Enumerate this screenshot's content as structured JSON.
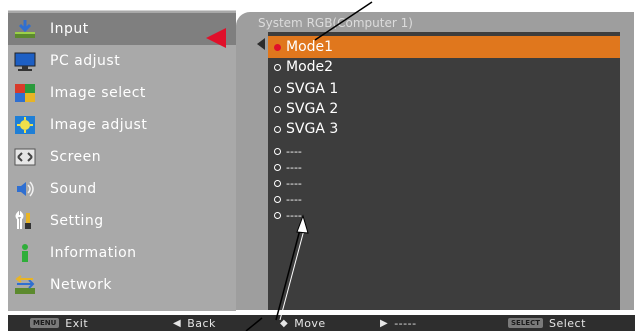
{
  "menu": {
    "items": [
      {
        "label": "Input",
        "icon": "input-icon"
      },
      {
        "label": "PC adjust",
        "icon": "monitor-icon"
      },
      {
        "label": "Image select",
        "icon": "image-select-icon"
      },
      {
        "label": "Image adjust",
        "icon": "image-adjust-icon"
      },
      {
        "label": "Screen",
        "icon": "screen-icon"
      },
      {
        "label": "Sound",
        "icon": "speaker-icon"
      },
      {
        "label": "Setting",
        "icon": "wrench-icon"
      },
      {
        "label": "Information",
        "icon": "information-icon"
      },
      {
        "label": "Network",
        "icon": "network-icon"
      }
    ],
    "selected_index": 0
  },
  "submenu": {
    "title": "System  RGB(Computer 1)",
    "options": [
      {
        "label": "Mode1",
        "selected": true
      },
      {
        "label": "Mode2",
        "selected": false
      },
      {
        "label": "SVGA 1",
        "selected": false
      },
      {
        "label": "SVGA 2",
        "selected": false
      },
      {
        "label": "SVGA 3",
        "selected": false
      },
      {
        "label": "----",
        "selected": false
      },
      {
        "label": "----",
        "selected": false
      },
      {
        "label": "----",
        "selected": false
      },
      {
        "label": "----",
        "selected": false
      },
      {
        "label": "----",
        "selected": false
      }
    ]
  },
  "bottom_bar": {
    "exit_key": "MENU",
    "exit_label": "Exit",
    "back_label": "Back",
    "move_label": "Move",
    "next_label": "-----",
    "select_key": "SELECT",
    "select_label": "Select"
  },
  "colors": {
    "highlight": "#e0771d",
    "pointer": "#e0102a",
    "menu_bg": "#a9a9a9",
    "list_bg": "#3d3d3d"
  }
}
